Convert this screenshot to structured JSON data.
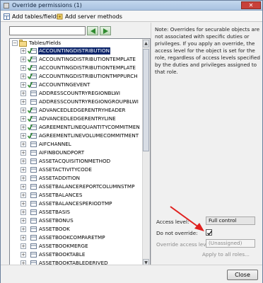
{
  "window": {
    "title": "Override permissions (1)",
    "close_glyph": "✕"
  },
  "toolbar": {
    "add_tables_label": "Add tables/fields",
    "add_server_label": "Add server methods"
  },
  "search": {
    "value": "",
    "placeholder": ""
  },
  "tree": {
    "root_label": "Tables/Fields",
    "selected_index": 0,
    "items": [
      {
        "label": "ACCOUNTINGDISTRIBUTION",
        "checked": true
      },
      {
        "label": "ACCOUNTINGDISTRIBUTIONTEMPLATE",
        "checked": true
      },
      {
        "label": "ACCOUNTINGDISTRIBUTIONTEMPLATE",
        "checked": true
      },
      {
        "label": "ACCOUNTINGDISTRIBUTIONTMPPURCH",
        "checked": true
      },
      {
        "label": "ACCOUNTINGEVENT",
        "checked": true
      },
      {
        "label": "ADDRESSCOUNTRYREGIONBLWI",
        "checked": false
      },
      {
        "label": "ADDRESSCOUNTRYREGIONGROUPBLWI",
        "checked": false
      },
      {
        "label": "ADVANCEDLEDGERENTRYHEADER",
        "checked": true
      },
      {
        "label": "ADVANCEDLEDGERENTRYLINE",
        "checked": true
      },
      {
        "label": "AGREEMENTLINEQUANTITYCOMMITMEN",
        "checked": true
      },
      {
        "label": "AGREEMENTLINEVOLUMECOMMITMENT",
        "checked": true
      },
      {
        "label": "AIFCHANNEL",
        "checked": false
      },
      {
        "label": "AIFINBOUNDPORT",
        "checked": false
      },
      {
        "label": "ASSETACQUISITIONMETHOD",
        "checked": false
      },
      {
        "label": "ASSETACTIVITYCODE",
        "checked": false
      },
      {
        "label": "ASSETADDITION",
        "checked": false
      },
      {
        "label": "ASSETBALANCEREPORTCOLUMNSTMP",
        "checked": false
      },
      {
        "label": "ASSETBALANCES",
        "checked": false
      },
      {
        "label": "ASSETBALANCESPERIODTMP",
        "checked": false
      },
      {
        "label": "ASSETBASIS",
        "checked": false
      },
      {
        "label": "ASSETBONUS",
        "checked": false
      },
      {
        "label": "ASSETBOOK",
        "checked": false
      },
      {
        "label": "ASSETBOOKCOMPARETMP",
        "checked": false
      },
      {
        "label": "ASSETBOOKMERGE",
        "checked": false
      },
      {
        "label": "ASSETBOOKTABLE",
        "checked": false
      },
      {
        "label": "ASSETBOOKTABLEDERIVED",
        "checked": false
      }
    ]
  },
  "note": "Note: Overrides for securable objects are not associated with specific duties or privileges. If you apply an override, the access level for the object is set for the role, regardless of access levels specified by the duties and privileges assigned to that role.",
  "form": {
    "access_level_label": "Access level:",
    "access_level_value": "Full control",
    "do_not_override_label": "Do not override:",
    "do_not_override_checked": true,
    "override_access_label": "Override access level:",
    "override_access_value": "(Unassigned)",
    "apply_all_label": "Apply to all roles..."
  },
  "footer": {
    "close_label": "Close"
  },
  "colors": {
    "accent_arrow": "#e0201e",
    "selection": "#0a246a"
  }
}
